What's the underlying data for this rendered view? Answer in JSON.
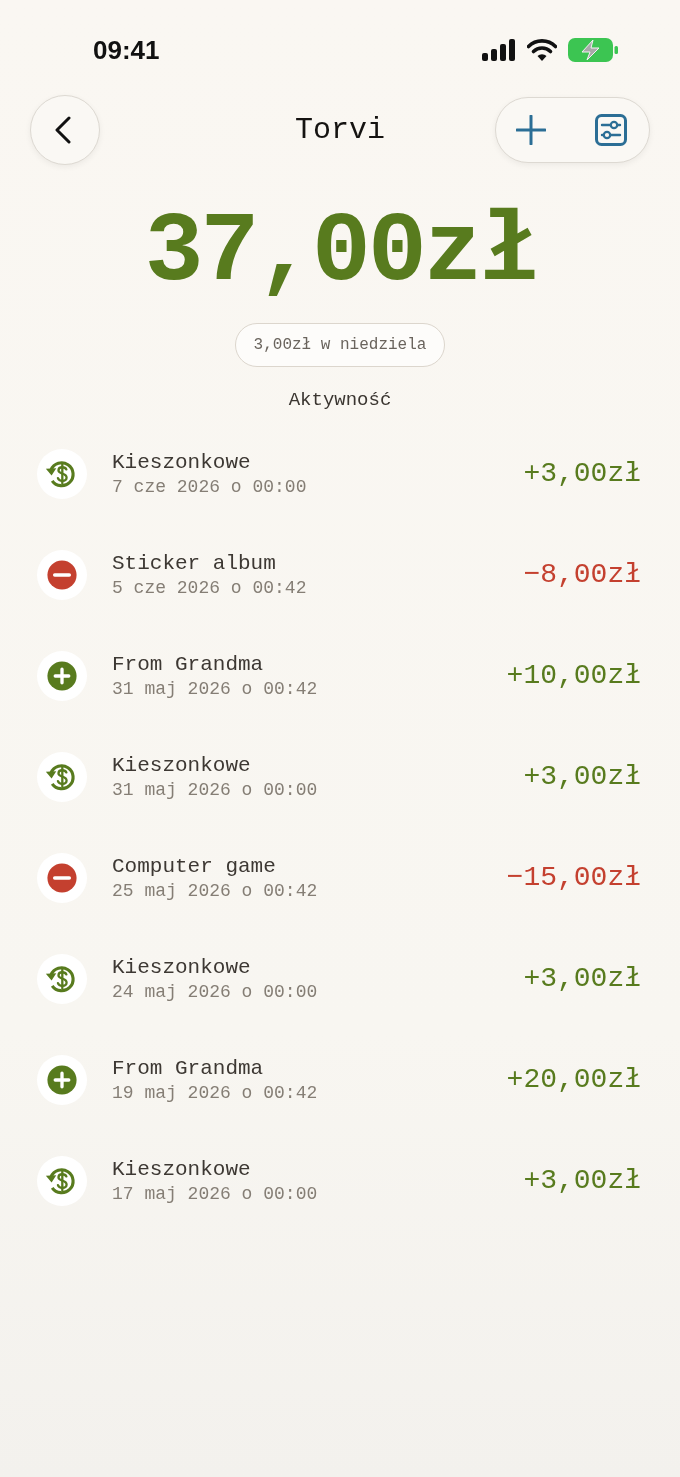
{
  "status_bar": {
    "time": "09:41"
  },
  "header": {
    "title": "Torvi"
  },
  "balance": {
    "amount": "37,00zł",
    "allowance": "3,00zł w niedziela"
  },
  "activity": {
    "heading": "Aktywność",
    "items": [
      {
        "kind": "allowance",
        "title": "Kieszonkowe",
        "date": "7 cze 2026 o 00:00",
        "amount": "+3,00zł"
      },
      {
        "kind": "spend",
        "title": "Sticker album",
        "date": "5 cze 2026 o 00:42",
        "amount": "−8,00zł"
      },
      {
        "kind": "gift",
        "title": "From Grandma",
        "date": "31 maj 2026 o 00:42",
        "amount": "+10,00zł"
      },
      {
        "kind": "allowance",
        "title": "Kieszonkowe",
        "date": "31 maj 2026 o 00:00",
        "amount": "+3,00zł"
      },
      {
        "kind": "spend",
        "title": "Computer game",
        "date": "25 maj 2026 o 00:42",
        "amount": "−15,00zł"
      },
      {
        "kind": "allowance",
        "title": "Kieszonkowe",
        "date": "24 maj 2026 o 00:00",
        "amount": "+3,00zł"
      },
      {
        "kind": "gift",
        "title": "From Grandma",
        "date": "19 maj 2026 o 00:42",
        "amount": "+20,00zł"
      },
      {
        "kind": "allowance",
        "title": "Kieszonkowe",
        "date": "17 maj 2026 o 00:00",
        "amount": "+3,00zł"
      }
    ]
  }
}
